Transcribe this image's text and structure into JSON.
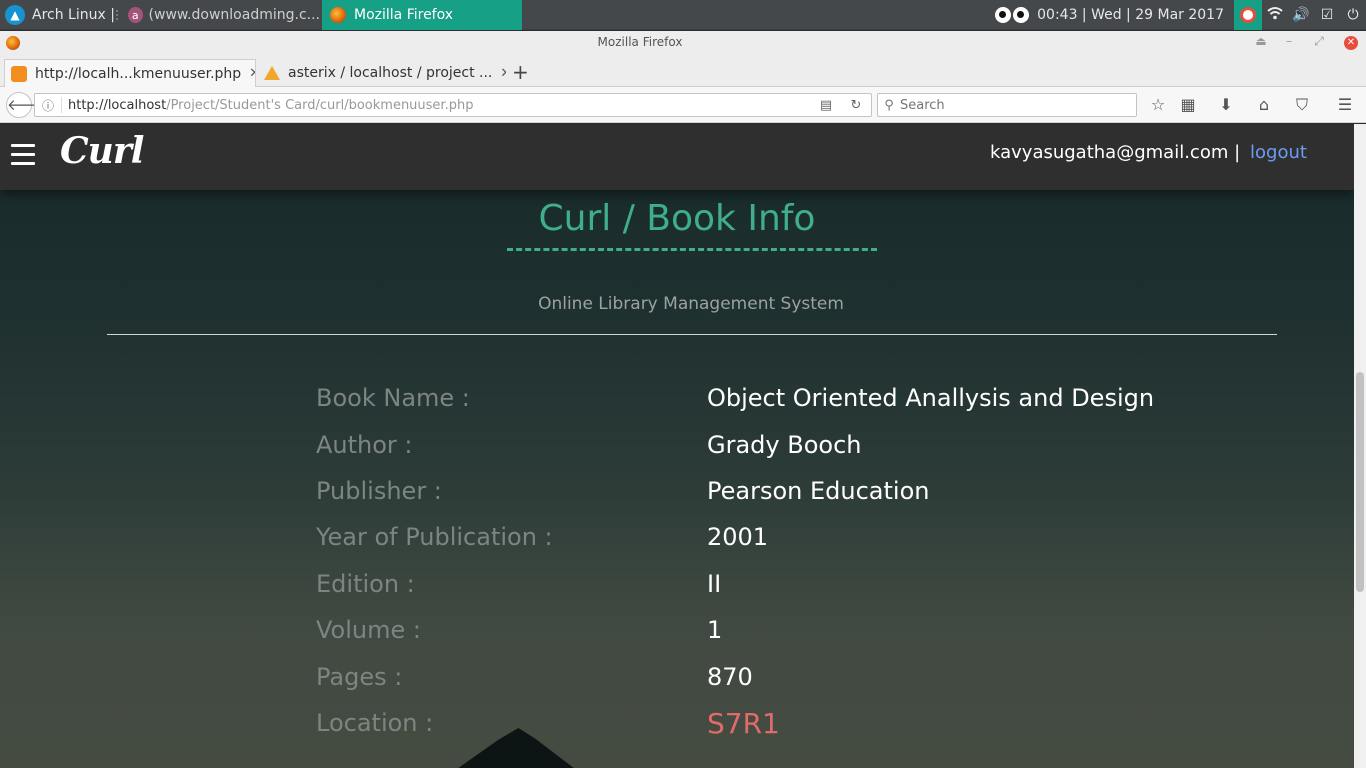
{
  "taskbar": {
    "arch_label": "Arch Linux |",
    "download_label": "(www.downloadming.c...",
    "firefox_label": "Mozilla Firefox",
    "clock": "00:43  |  Wed  |  29 Mar 2017"
  },
  "window": {
    "title": "Mozilla Firefox"
  },
  "tabs": [
    {
      "title": "http://localh...kmenuuser.php"
    },
    {
      "title": "asterix / localhost / project ..."
    }
  ],
  "navbar": {
    "url_host": "http://localhost",
    "url_path": "/Project/Student's Card/curl/bookmenuuser.php",
    "search_placeholder": "Search"
  },
  "app": {
    "brand": "Curl",
    "user_email": "kavyasugatha@gmail.com |",
    "logout_label": "logout",
    "page_title": "Curl / Book Info",
    "subtitle": "Online Library Management System"
  },
  "book_info": [
    {
      "label": "Book Name :",
      "value": "Object Oriented Anallysis and Design"
    },
    {
      "label": "Author :",
      "value": "Grady Booch"
    },
    {
      "label": "Publisher :",
      "value": "Pearson Education"
    },
    {
      "label": "Year of Publication :",
      "value": "2001"
    },
    {
      "label": "Edition :",
      "value": "II"
    },
    {
      "label": "Volume :",
      "value": "1"
    },
    {
      "label": "Pages :",
      "value": "870"
    },
    {
      "label": "Location :",
      "value": "S7R1"
    }
  ],
  "colors": {
    "accent": "#3fae8a",
    "location": "#e06b6b",
    "logout_link": "#6d9cf2",
    "taskbar_active": "#16a085"
  }
}
